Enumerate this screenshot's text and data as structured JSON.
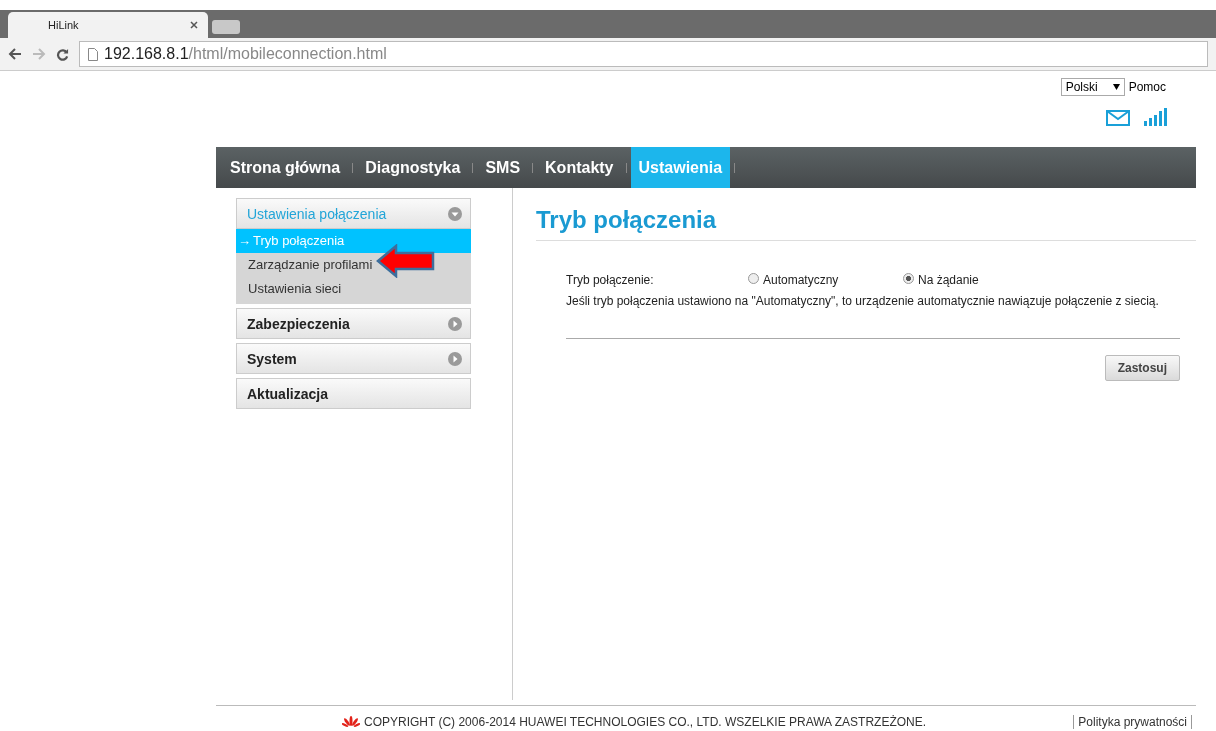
{
  "browser": {
    "tab_title": "HiLink",
    "url_host": "192.168.8.1",
    "url_path": "/html/mobileconnection.html"
  },
  "header": {
    "language": "Polski",
    "help": "Pomoc"
  },
  "nav": [
    {
      "label": "Strona główna",
      "selected": false
    },
    {
      "label": "Diagnostyka",
      "selected": false
    },
    {
      "label": "SMS",
      "selected": false
    },
    {
      "label": "Kontakty",
      "selected": false
    },
    {
      "label": "Ustawienia",
      "selected": true
    }
  ],
  "sidebar": [
    {
      "label": "Ustawienia połączenia",
      "expanded": true,
      "has_toggle": true,
      "children": [
        {
          "label": "Tryb połączenia",
          "selected": true,
          "marker": "→"
        },
        {
          "label": "Zarządzanie profilami",
          "selected": false
        },
        {
          "label": "Ustawienia sieci",
          "selected": false
        }
      ]
    },
    {
      "label": "Zabezpieczenia",
      "expanded": false,
      "has_toggle": true
    },
    {
      "label": "System",
      "expanded": false,
      "has_toggle": true
    },
    {
      "label": "Aktualizacja",
      "expanded": false,
      "has_toggle": false
    }
  ],
  "content": {
    "title": "Tryb połączenia",
    "field_label": "Tryb połączenie:",
    "options": [
      {
        "label": "Automatyczny",
        "selected": false
      },
      {
        "label": "Na żądanie",
        "selected": true
      }
    ],
    "note": "Jeśli tryb połączenia ustawiono na \"Automatyczny\", to urządzenie automatycznie nawiązuje połączenie z siecią.",
    "button": "Zastosuj"
  },
  "footer": {
    "copyright": "COPYRIGHT (C) 2006-2014 HUAWEI TECHNOLOGIES CO., LTD. WSZELKIE PRAWA ZASTRZEŻONE.",
    "privacy": "Polityka prywatności"
  }
}
